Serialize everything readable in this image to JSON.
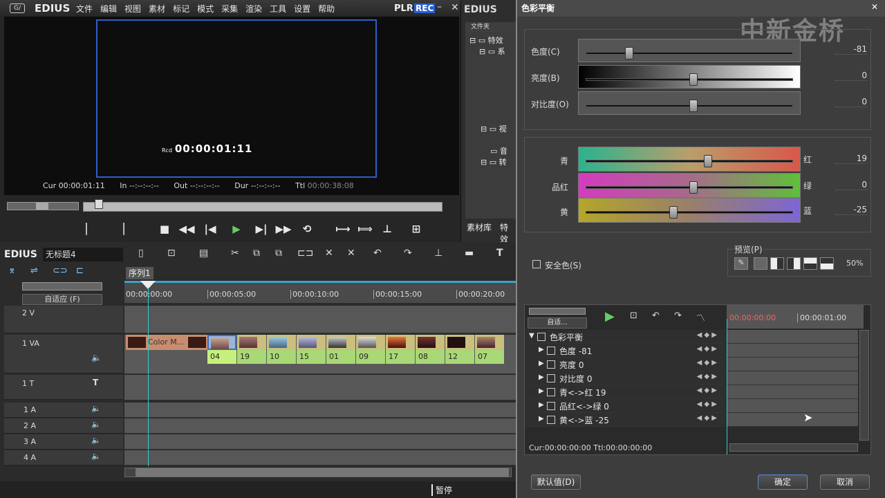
{
  "app": {
    "logo": "EDIUS",
    "plr": "PLR",
    "rec": "REC"
  },
  "menu": [
    "文件",
    "编辑",
    "视图",
    "素材",
    "标记",
    "模式",
    "采集",
    "渲染",
    "工具",
    "设置",
    "帮助"
  ],
  "player": {
    "rcd_label": "Rcd",
    "rcd_tc": "00:00:01:11",
    "cur_label": "Cur",
    "cur": "00:00:01:11",
    "in_label": "In",
    "in": "--:--:--:--",
    "out_label": "Out",
    "out": "--:--:--:--",
    "dur_label": "Dur",
    "dur": "--:--:--:--",
    "ttl_label": "Ttl",
    "ttl": "00:00:38:08"
  },
  "bin": {
    "logo": "EDIUS",
    "header": "文件夹",
    "items": [
      "特效",
      "系",
      "视",
      "音",
      "转"
    ],
    "tabs": [
      "素材库",
      "特效"
    ]
  },
  "timeline": {
    "logo": "EDIUS",
    "project": "无标题4",
    "sequence_tab": "序列1",
    "fit_label": "自适应 (F)",
    "ruler": [
      "00:00:00:00",
      "00:00:05:00",
      "00:00:10:00",
      "00:00:15:00",
      "00:00:20:00"
    ],
    "tracks": {
      "v2": "2 V",
      "va1": "1 VA",
      "a_pair": "A",
      "t1": "1 T",
      "a1": "1 A",
      "a2": "2 A",
      "a3": "3 A",
      "a4": "4 A"
    },
    "color_matte_label": "Color M...",
    "audio_clips": [
      "04",
      "19",
      "10",
      "15",
      "01",
      "09",
      "17",
      "08",
      "12",
      "07"
    ]
  },
  "status": {
    "text": "暂停"
  },
  "dialog": {
    "title": "色彩平衡",
    "watermark": "中新金桥",
    "sliders1": [
      {
        "label": "色度(C)",
        "value": "-81",
        "pos": 0.19
      },
      {
        "label": "亮度(B)",
        "value": "0",
        "pos": 0.5
      },
      {
        "label": "对比度(O)",
        "value": "0",
        "pos": 0.5
      }
    ],
    "sliders2": [
      {
        "left": "青",
        "right": "红",
        "value": "19",
        "pos": 0.57
      },
      {
        "left": "品红",
        "right": "绿",
        "value": "0",
        "pos": 0.5
      },
      {
        "left": "黄",
        "right": "蓝",
        "value": "-25",
        "pos": 0.4
      }
    ],
    "safe_color": "安全色(S)",
    "preview_label": "预览(P)",
    "preview_pct": "50%",
    "kf_fit": "自适...",
    "kf_ruler": [
      "00:00:00:00",
      "00:00:01:00"
    ],
    "kf_rows": [
      "色彩平衡",
      "色度  -81",
      "亮度  0",
      "对比度  0",
      "青<->红  19",
      "品红<->绿  0",
      "黄<->蓝  -25"
    ],
    "kf_status": "Cur:00:00:00:00 Ttl:00:00:00:00",
    "default_btn": "默认值(D)",
    "ok_btn": "确定",
    "cancel_btn": "取消"
  }
}
